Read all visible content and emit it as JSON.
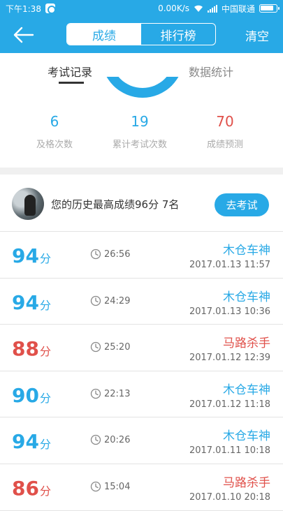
{
  "status_bar": {
    "time": "下午1:38",
    "network_speed": "0.00K/s",
    "carrier": "中国联通"
  },
  "header": {
    "tabs": [
      "成绩",
      "排行榜"
    ],
    "active_tab": "成绩",
    "clear_label": "清空"
  },
  "sub_tabs": [
    "考试记录",
    "数据统计"
  ],
  "stats": [
    {
      "value": "6",
      "label": "及格次数",
      "color": "#28a9e6"
    },
    {
      "value": "19",
      "label": "累计考试次数",
      "color": "#28a9e6"
    },
    {
      "value": "70",
      "label": "成绩预测",
      "color": "#e0504a"
    }
  ],
  "best": {
    "text": "您的历史最高成绩96分  7名",
    "button": "去考试"
  },
  "records": [
    {
      "score": "94",
      "unit": "分",
      "duration": "26:56",
      "title": "木仓车神",
      "datetime": "2017.01.13  11:57",
      "color": "#28a9e6"
    },
    {
      "score": "94",
      "unit": "分",
      "duration": "24:29",
      "title": "木仓车神",
      "datetime": "2017.01.13  10:36",
      "color": "#28a9e6"
    },
    {
      "score": "88",
      "unit": "分",
      "duration": "25:20",
      "title": "马路杀手",
      "datetime": "2017.01.12  12:39",
      "color": "#e0504a"
    },
    {
      "score": "90",
      "unit": "分",
      "duration": "22:13",
      "title": "木仓车神",
      "datetime": "2017.01.12  11:18",
      "color": "#28a9e6"
    },
    {
      "score": "94",
      "unit": "分",
      "duration": "20:26",
      "title": "木仓车神",
      "datetime": "2017.01.11  10:18",
      "color": "#28a9e6"
    },
    {
      "score": "86",
      "unit": "分",
      "duration": "15:04",
      "title": "马路杀手",
      "datetime": "2017.01.10  20:18",
      "color": "#e0504a"
    }
  ]
}
